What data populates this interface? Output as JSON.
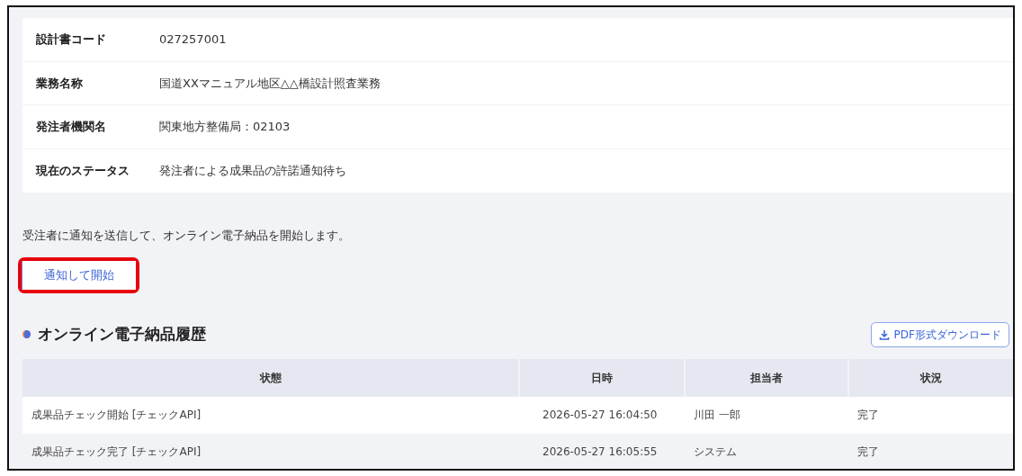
{
  "info_rows": [
    {
      "label": "設計書コード",
      "value": "027257001"
    },
    {
      "label": "業務名称",
      "value": "国道XXマニュアル地区△△橋設計照査業務"
    },
    {
      "label": "発注者機関名",
      "value": "関東地方整備局：02103"
    },
    {
      "label": "現在のステータス",
      "value": "発注者による成果品の許諾通知待ち"
    }
  ],
  "notice": "受注者に通知を送信して、オンライン電子納品を開始します。",
  "start_button": {
    "label": "通知して開始",
    "highlighted": true
  },
  "history": {
    "title": "オンライン電子納品履歴",
    "download_button": "PDF形式ダウンロード",
    "columns": [
      "状態",
      "日時",
      "担当者",
      "状況"
    ],
    "rows": [
      [
        "成果品チェック開始 [チェックAPI]",
        "2026-05-27 16:04:50",
        "川田 一郎",
        "完了"
      ],
      [
        "成果品チェック完了 [チェックAPI]",
        "2026-05-27 16:05:55",
        "システム",
        "完了"
      ]
    ]
  }
}
